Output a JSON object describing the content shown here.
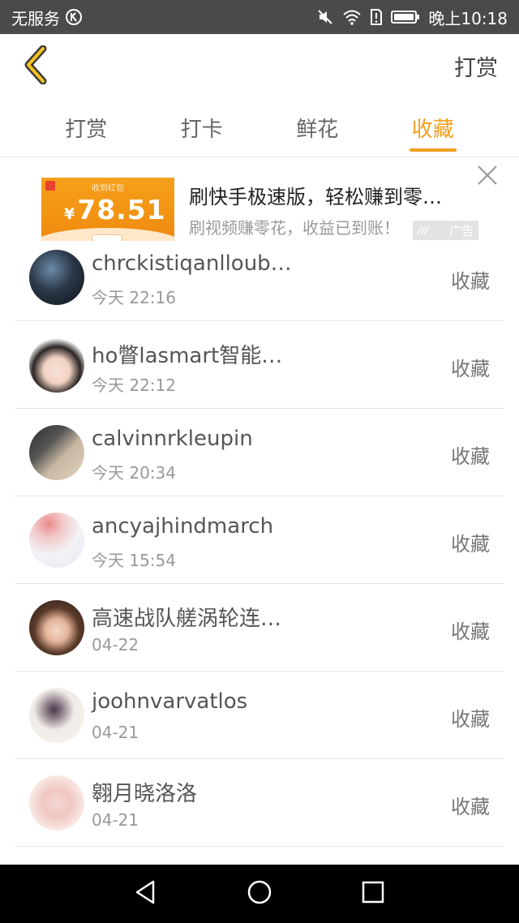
{
  "status_bar": {
    "carrier": "无服务",
    "time": "晚上10:18"
  },
  "header": {
    "back_icon": "chevron-left-icon",
    "action_label": "打赏"
  },
  "tabs": [
    {
      "label": "打赏",
      "active": false
    },
    {
      "label": "打卡",
      "active": false
    },
    {
      "label": "鲜花",
      "active": false
    },
    {
      "label": "收藏",
      "active": true
    }
  ],
  "ad": {
    "thumb_caption": "收到红包",
    "thumb_currency": "¥",
    "thumb_amount": "78.51",
    "title": "刷快手极速版，轻松赚到零…",
    "description": "刷视频赚零花，收益已到账！",
    "tag": "广告"
  },
  "list": [
    {
      "name": "chrckistiqanlloub…",
      "time": "今天 22:16",
      "action": "收藏"
    },
    {
      "name": "ho瞥lasmart智能…",
      "time": "今天 22:12",
      "action": "收藏"
    },
    {
      "name": "calvinnrkleupin",
      "time": "今天 20:34",
      "action": "收藏"
    },
    {
      "name": "ancyajhindmarch",
      "time": "今天 15:54",
      "action": "收藏"
    },
    {
      "name": "高速战队艖涡轮连…",
      "time": "04-22",
      "action": "收藏"
    },
    {
      "name": "joohnvarvatlos",
      "time": "04-21",
      "action": "收藏"
    },
    {
      "name": "翱月晓洛洛",
      "time": "04-21",
      "action": "收藏"
    }
  ],
  "colors": {
    "accent": "#f0a020",
    "status_bar": "#4a4a4a",
    "nav_bar": "#000000"
  }
}
